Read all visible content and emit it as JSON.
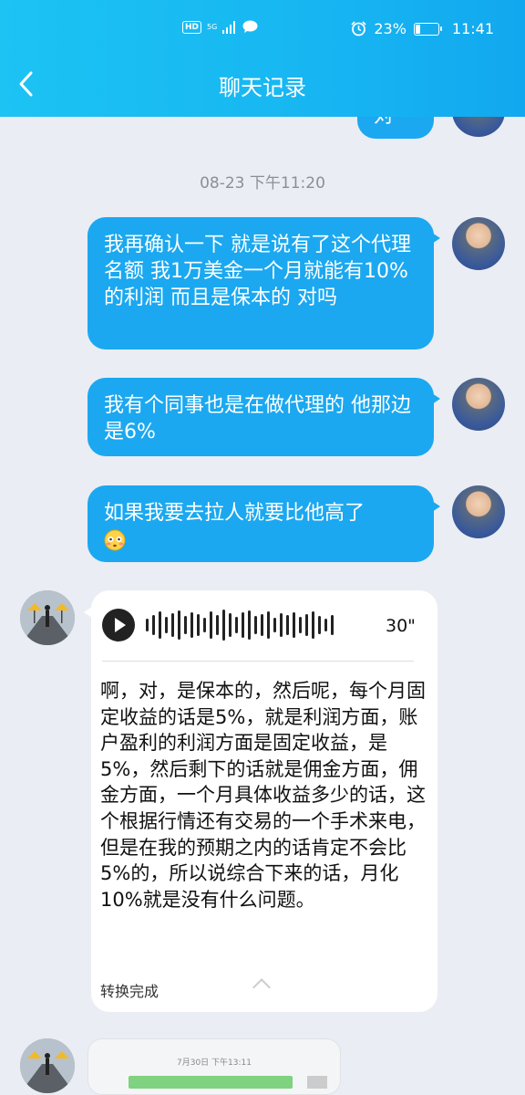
{
  "status_bar": {
    "hd_label": "HD",
    "network_label": "5G",
    "battery_percent": "23%",
    "battery_level": 0.23,
    "time": "11:41"
  },
  "header": {
    "title": "聊天记录"
  },
  "chat": {
    "top_partial_text": "对 的",
    "timestamp": "08-23 下午11:20",
    "sent_messages": [
      "我再确认一下   就是说有了这个代理名额 我1万美金一个月就能有10%的利润 而且是保本的  对吗",
      "我有个同事也是在做代理的  他那边是6%",
      "如果我要去拉人就要比他高了"
    ],
    "emoji_name": "flushed-face-emoji",
    "voice": {
      "duration": "30\"",
      "transcript": "啊，对，是保本的，然后呢，每个月固定收益的话是5%，就是利润方面，账户盈利的利润方面是固定收益，是5%，然后剩下的话就是佣金方面，佣金方面，一个月具体收益多少的话，这个根据行情还有交易的一个手术来电，但是在我的预期之内的话肯定不会比5%的，所以说综合下来的话，月化10%就是没有什么问题。",
      "status": "转换完成"
    },
    "image_card": {
      "time_text": "7月30日 下午13:11"
    }
  },
  "colors": {
    "header": "#17b6f2",
    "bubble_sent": "#1ba8f0",
    "background": "#eaedf4"
  }
}
